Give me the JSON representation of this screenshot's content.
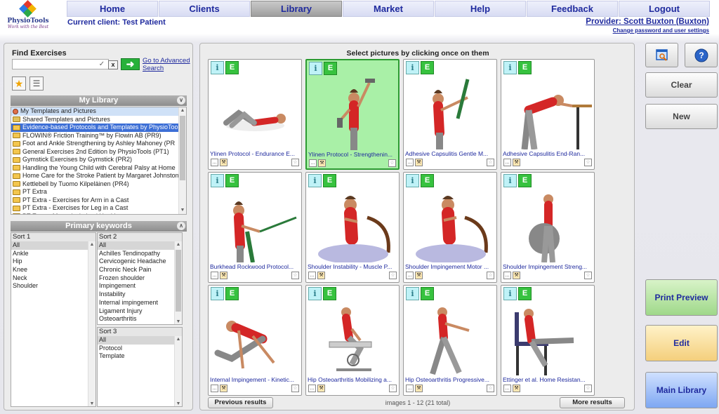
{
  "brand": {
    "name": "PhysioTools",
    "tagline": "Work with the Best"
  },
  "nav": [
    "Home",
    "Clients",
    "Library",
    "Market",
    "Help",
    "Feedback",
    "Logout"
  ],
  "nav_active": "Library",
  "current_client": "Current client: Test Patient",
  "provider": "Provider: Scott Buxton (Buxton)",
  "change_password": "Change password and user settings",
  "find": {
    "label": "Find Exercises",
    "search_value": "",
    "clear_label": "x",
    "advanced_search": "Go to Advanced Search"
  },
  "my_library": {
    "title": "My Library",
    "items": [
      "My Templates and Pictures",
      "Shared Templates and Pictures",
      "Evidence-based Protocols and Templates by PhysioTools",
      "FLOWIN® Friction Training™ by Flowin AB (PR9)",
      "Foot and Ankle Strengthening by Ashley Mahoney (PR",
      "General Exercises 2nd Edition by PhysioTools (PT1)",
      "Gymstick Exercises by Gymstick (PR2)",
      "Handling the Young Child with Cerebral Palsy at Home",
      "Home Care for the Stroke Patient by Margaret Johnstone",
      "Kettlebell by Tuomo Kilpeläinen (PR4)",
      "PT Extra",
      "PT Extra - Exercises for Arm in a Cast",
      "PT Extra - Exercises for Leg in a Cast",
      "PT Extra - Musculoskeletal Health"
    ]
  },
  "keywords": {
    "title": "Primary keywords",
    "sort1": {
      "title": "Sort 1",
      "items": [
        "All",
        "Ankle",
        "Hip",
        "Knee",
        "Neck",
        "Shoulder"
      ]
    },
    "sort2": {
      "title": "Sort 2",
      "items": [
        "All",
        "Achilles Tendinopathy",
        "Cervicogenic Headache",
        "Chronic Neck Pain",
        "Frozen shoulder",
        "Impingement",
        "Instability",
        "Internal impingement",
        "Ligament Injury",
        "Osteoarthritis"
      ]
    },
    "sort3": {
      "title": "Sort 3",
      "items": [
        "All",
        "Protocol",
        "Template"
      ]
    }
  },
  "results": {
    "hint": "Select pictures by clicking once on them",
    "cards": [
      "Ylinen Protocol - Endurance E...",
      "Ylinen Protocol - Strengthenin...",
      "Adhesive Capsulitis Gentle M...",
      "Adhesive Capsulitis End-Ran...",
      "Burkhead Rockwood Protocol...",
      "Shoulder Instability - Muscle P...",
      "Shoulder Impingement Motor ...",
      "Shoulder Impingement Streng...",
      "Internal Impingement - Kinetic...",
      "Hip Osteoarthritis Mobilizing a...",
      "Hip Osteoarthritis Progressive...",
      "Ettinger et al. Home Resistan..."
    ],
    "selected_index": 1,
    "badge_info": "i",
    "badge_ebp": "E",
    "prev": "Previous results",
    "next": "More results",
    "pager": "images 1 - 12 (21 total)"
  },
  "right": {
    "clear": "Clear",
    "new": "New",
    "print_preview": "Print Preview",
    "edit": "Edit",
    "main_library": "Main Library"
  }
}
